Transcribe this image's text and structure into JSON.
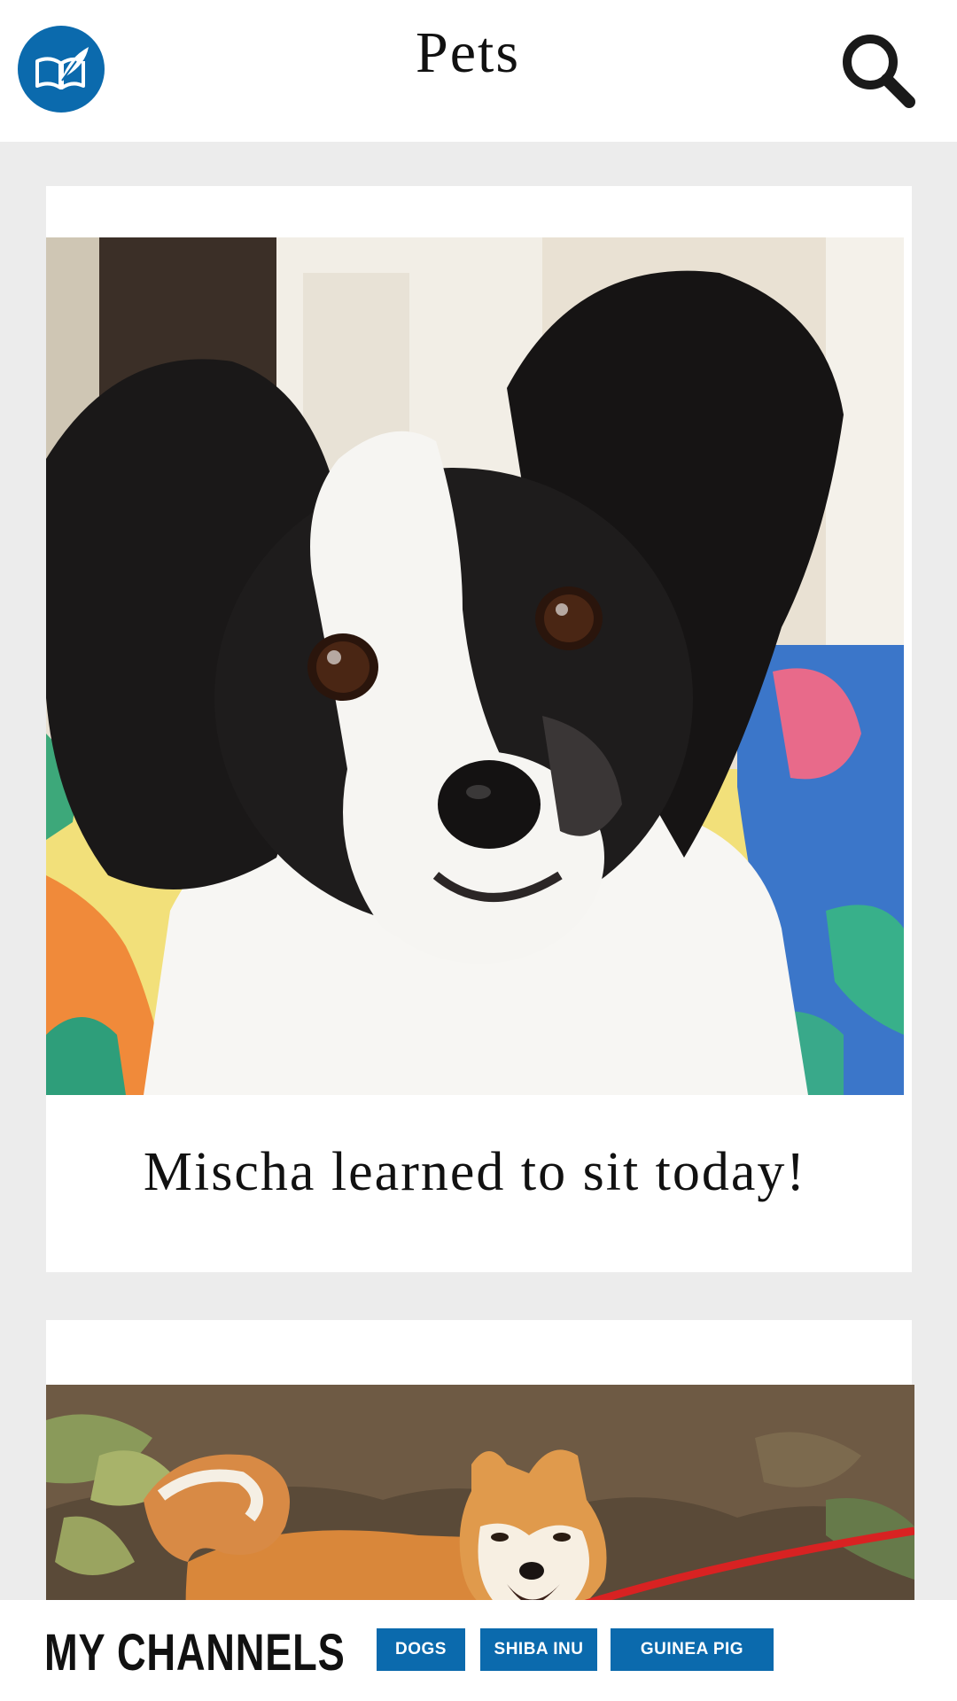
{
  "header": {
    "title": "Pets",
    "logo_icon": "book-quill-icon",
    "search_icon": "search-icon"
  },
  "feed": {
    "posts": [
      {
        "image_alt": "Black and white papillon dog looking at camera",
        "caption": "Mischa learned to sit today!"
      },
      {
        "image_alt": "Shiba inu dog on a red leash outdoors",
        "caption": ""
      }
    ]
  },
  "bottom_bar": {
    "title": "MY CHANNELS",
    "channels": [
      "DOGS",
      "SHIBA INU",
      "GUINEA PIG"
    ]
  },
  "colors": {
    "accent": "#0b6aad",
    "background": "#ececec",
    "card": "#ffffff"
  }
}
